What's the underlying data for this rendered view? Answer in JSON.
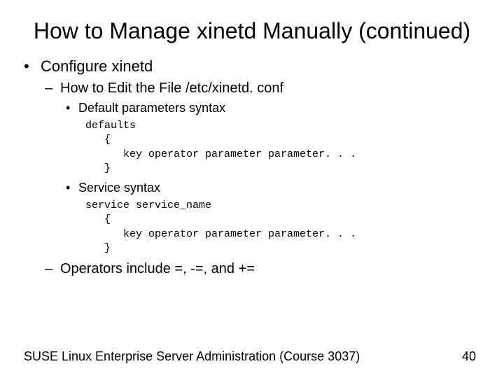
{
  "title": "How to Manage xinetd Manually (continued)",
  "bullets": {
    "l1": "Configure xinetd",
    "l2a": "How to Edit the File /etc/xinetd. conf",
    "l3a": "Default parameters syntax",
    "code1_line1": "defaults",
    "code1_line2": "   {",
    "code1_line3": "      key operator parameter parameter. . .",
    "code1_line4": "   }",
    "l3b": "Service syntax",
    "code2_line1": "service service_name",
    "code2_line2": "   {",
    "code2_line3": "      key operator parameter parameter. . .",
    "code2_line4": "   }",
    "l2b": "Operators include =, -=, and +="
  },
  "footer": {
    "left": "SUSE Linux Enterprise Server Administration (Course 3037)",
    "right": "40"
  }
}
